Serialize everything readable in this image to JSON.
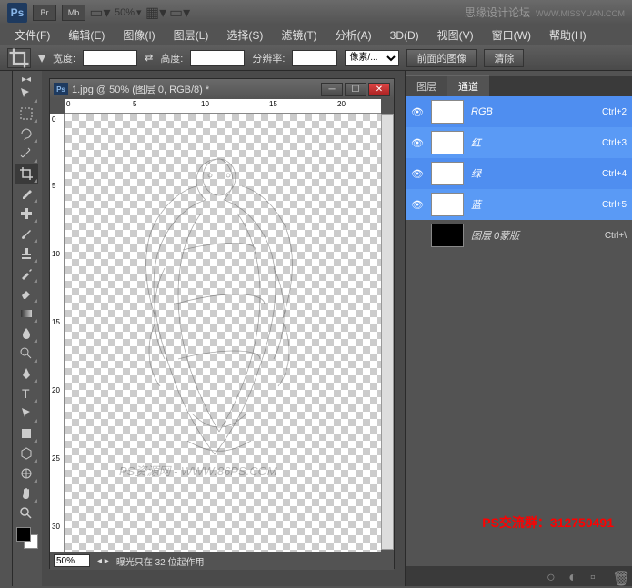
{
  "topbar": {
    "ps_badge": "Ps",
    "mode_br": "Br",
    "mode_mb": "Mb",
    "zoom": "50%",
    "watermark": "思缘设计论坛",
    "watermark_url": "WWW.MISSYUAN.COM"
  },
  "menu": [
    "文件(F)",
    "编辑(E)",
    "图像(I)",
    "图层(L)",
    "选择(S)",
    "滤镜(T)",
    "分析(A)",
    "3D(D)",
    "视图(V)",
    "窗口(W)",
    "帮助(H)"
  ],
  "options": {
    "width_label": "宽度:",
    "height_label": "高度:",
    "resolution_label": "分辨率:",
    "unit": "像素/...",
    "btn_front": "前面的图像",
    "btn_clear": "清除"
  },
  "document": {
    "title": "1.jpg @ 50% (图层 0, RGB/8) *",
    "zoom_status": "50%",
    "status_text": "曝光只在 32 位起作用",
    "art_watermark": "PS资源网 - WWW.86PS.COM"
  },
  "panel": {
    "tab_layers": "图层",
    "tab_channels": "通道",
    "channels": [
      {
        "name": "RGB",
        "shortcut": "Ctrl+2",
        "selected": true,
        "thumb": "white"
      },
      {
        "name": "红",
        "shortcut": "Ctrl+3",
        "selected": true,
        "thumb": "white"
      },
      {
        "name": "绿",
        "shortcut": "Ctrl+4",
        "selected": true,
        "thumb": "white"
      },
      {
        "name": "蓝",
        "shortcut": "Ctrl+5",
        "selected": true,
        "thumb": "white"
      },
      {
        "name": "图层 0蒙版",
        "shortcut": "Ctrl+\\",
        "selected": false,
        "thumb": "black"
      }
    ]
  },
  "red_text": "PS交流群：312750491",
  "ruler_h": [
    "0",
    "5",
    "10",
    "15",
    "20"
  ],
  "ruler_v": [
    "0",
    "5",
    "10",
    "15",
    "20",
    "25",
    "30"
  ]
}
